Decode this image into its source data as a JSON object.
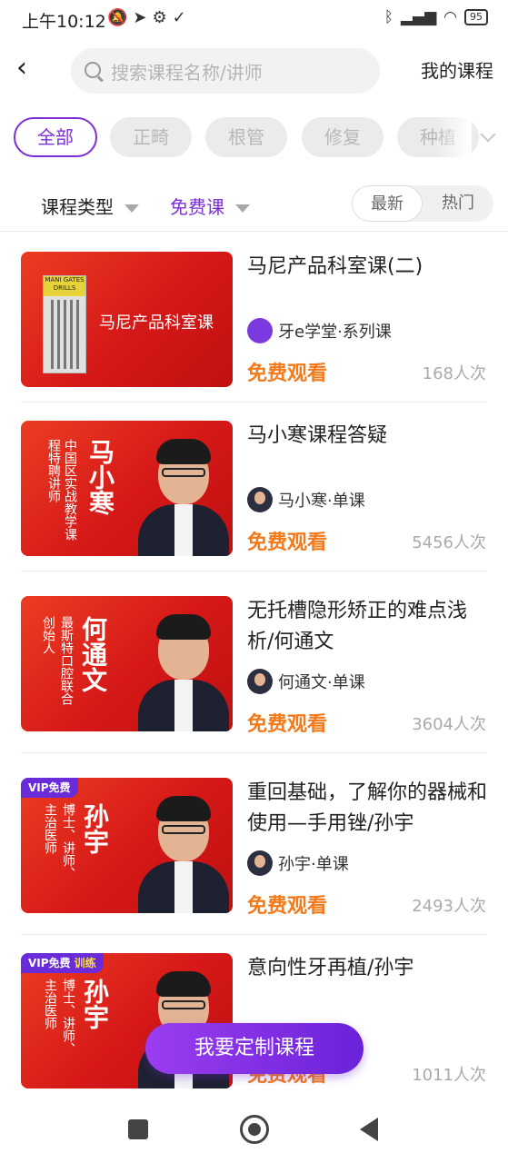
{
  "status_bar": {
    "time": "上午10:12",
    "left_icons": [
      "mute-icon",
      "telegram-icon",
      "gear-icon",
      "download-done-icon"
    ],
    "right_icons": [
      "bluetooth-icon",
      "signal-icon",
      "wifi-icon"
    ],
    "battery": "95"
  },
  "header": {
    "search_placeholder": "搜索课程名称/讲师",
    "my_courses": "我的课程"
  },
  "categories": [
    "全部",
    "正畸",
    "根管",
    "修复",
    "种植"
  ],
  "filters": {
    "type_label": "课程类型",
    "price_label": "免费课",
    "sort_options": [
      "最新",
      "热门"
    ],
    "sort_selected": "最新"
  },
  "courses": [
    {
      "title": "马尼产品科室课(二)",
      "author": "牙e学堂·系列课",
      "price_label": "免费观看",
      "views": "168人次",
      "thumb_title": "马尼产品科室课",
      "thumb_box_label": "MANI GATES DRILLS"
    },
    {
      "title": "马小寒课程答疑",
      "author": "马小寒·单课",
      "price_label": "免费观看",
      "views": "5456人次",
      "thumb_name": "马小寒",
      "thumb_desc": [
        "中国区实战教学课",
        "程特聘讲师"
      ]
    },
    {
      "title": "无托槽隐形矫正的难点浅析/何通文",
      "author": "何通文·单课",
      "price_label": "免费观看",
      "views": "3604人次",
      "thumb_name": "何通文",
      "thumb_desc": [
        "最斯特口腔联合",
        "创始人"
      ]
    },
    {
      "title": "重回基础，了解你的器械和使用—手用锉/孙宇",
      "author": "孙宇·单课",
      "price_label": "免费观看",
      "views": "2493人次",
      "thumb_name": "孙宇",
      "thumb_desc": [
        "博士、讲师、",
        "主治医师"
      ],
      "badge": "VIP免费"
    },
    {
      "title": "意向性牙再植/孙宇",
      "author": "",
      "price_label": "免费观看",
      "views": "1011人次",
      "thumb_name": "孙宇",
      "thumb_desc": [
        "博士、讲师、",
        "主治医师"
      ],
      "badge": "VIP免费",
      "badge2": "训练"
    }
  ],
  "fab_label": "我要定制课程",
  "colors": {
    "accent": "#7b2fd6",
    "free": "#f27a1a",
    "thumb_red": "#d51818"
  }
}
